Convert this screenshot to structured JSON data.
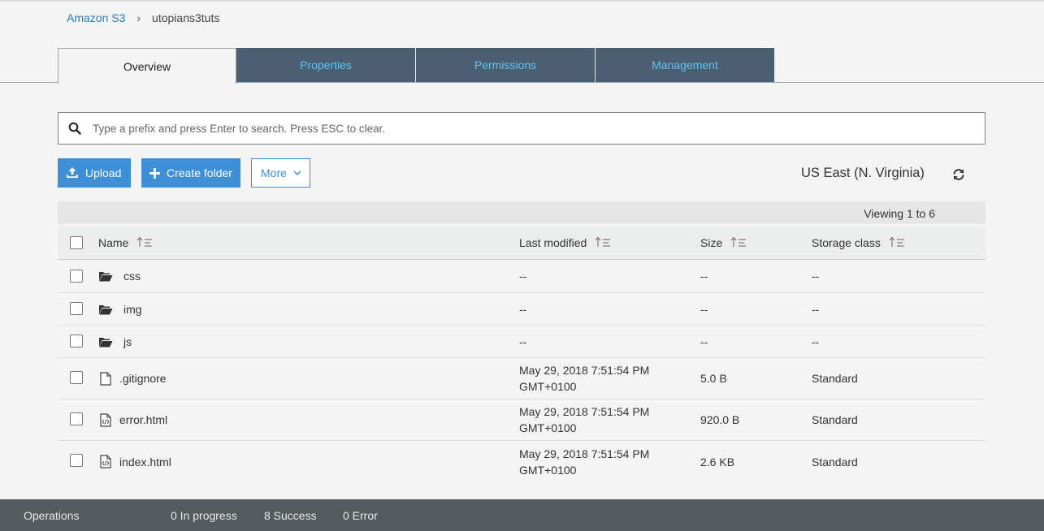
{
  "breadcrumb": {
    "root": "Amazon S3",
    "separator": "›",
    "bucket": "utopians3tuts"
  },
  "tabs": [
    {
      "label": "Overview",
      "active": true
    },
    {
      "label": "Properties",
      "active": false
    },
    {
      "label": "Permissions",
      "active": false
    },
    {
      "label": "Management",
      "active": false
    }
  ],
  "search": {
    "placeholder": "Type a prefix and press Enter to search. Press ESC to clear.",
    "icon": "search-icon"
  },
  "toolbar": {
    "upload_label": "Upload",
    "create_folder_label": "Create folder",
    "more_label": "More",
    "region": "US East (N. Virginia)"
  },
  "listing": {
    "viewing": "Viewing 1 to 6"
  },
  "table": {
    "headers": {
      "name": "Name",
      "last_modified": "Last modified",
      "size": "Size",
      "storage_class": "Storage class"
    },
    "rows": [
      {
        "type": "folder",
        "name": "css",
        "modified_1": "--",
        "modified_2": "",
        "size": "--",
        "storage_class": "--"
      },
      {
        "type": "folder",
        "name": "img",
        "modified_1": "--",
        "modified_2": "",
        "size": "--",
        "storage_class": "--"
      },
      {
        "type": "folder",
        "name": "js",
        "modified_1": "--",
        "modified_2": "",
        "size": "--",
        "storage_class": "--"
      },
      {
        "type": "file",
        "name": ".gitignore",
        "modified_1": "May 29, 2018 7:51:54 PM",
        "modified_2": "GMT+0100",
        "size": "5.0 B",
        "storage_class": "Standard"
      },
      {
        "type": "code",
        "name": "error.html",
        "modified_1": "May 29, 2018 7:51:54 PM",
        "modified_2": "GMT+0100",
        "size": "920.0 B",
        "storage_class": "Standard"
      },
      {
        "type": "code",
        "name": "index.html",
        "modified_1": "May 29, 2018 7:51:54 PM",
        "modified_2": "GMT+0100",
        "size": "2.6 KB",
        "storage_class": "Standard"
      }
    ]
  },
  "footer": {
    "operations": "Operations",
    "in_progress": "0 In progress",
    "success": "8 Success",
    "error": "0 Error"
  },
  "colors": {
    "tab_bg": "#4b5f72",
    "tab_text": "#5fc3f1",
    "primary": "#3d8fd8",
    "footer_bg": "#545b5f"
  }
}
